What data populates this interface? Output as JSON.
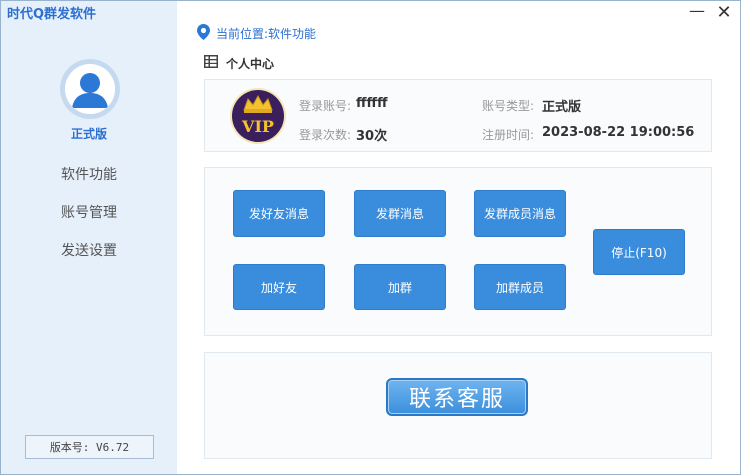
{
  "app": {
    "title": "时代Q群发软件",
    "accent_color": "#2c6fd1",
    "button_color": "#3a8ddd"
  },
  "window_controls": {
    "minimize_glyph": "—",
    "close_glyph": "✕"
  },
  "sidebar": {
    "edition": "正式版",
    "items": [
      {
        "label": "软件功能"
      },
      {
        "label": "账号管理"
      },
      {
        "label": "发送设置"
      }
    ],
    "version": "版本号: V6.72"
  },
  "breadcrumb": {
    "text": "当前位置:软件功能",
    "icon": "location-pin-icon"
  },
  "section": {
    "title": "个人中心",
    "icon": "list-icon"
  },
  "account": {
    "badge_text": "VIP",
    "login_account_label": "登录账号:",
    "login_account_value": "ffffff",
    "account_type_label": "账号类型:",
    "account_type_value": "正式版",
    "login_count_label": "登录次数:",
    "login_count_value": "30次",
    "register_time_label": "注册时间:",
    "register_time_value": "2023-08-22 19:00:56"
  },
  "actions": {
    "send_friend_msg": "发好友消息",
    "send_group_msg": "发群消息",
    "send_group_member_msg": "发群成员消息",
    "add_friend": "加好友",
    "add_group": "加群",
    "add_group_member": "加群成员",
    "stop": "停止(F10)"
  },
  "contact": {
    "label": "联系客服"
  }
}
